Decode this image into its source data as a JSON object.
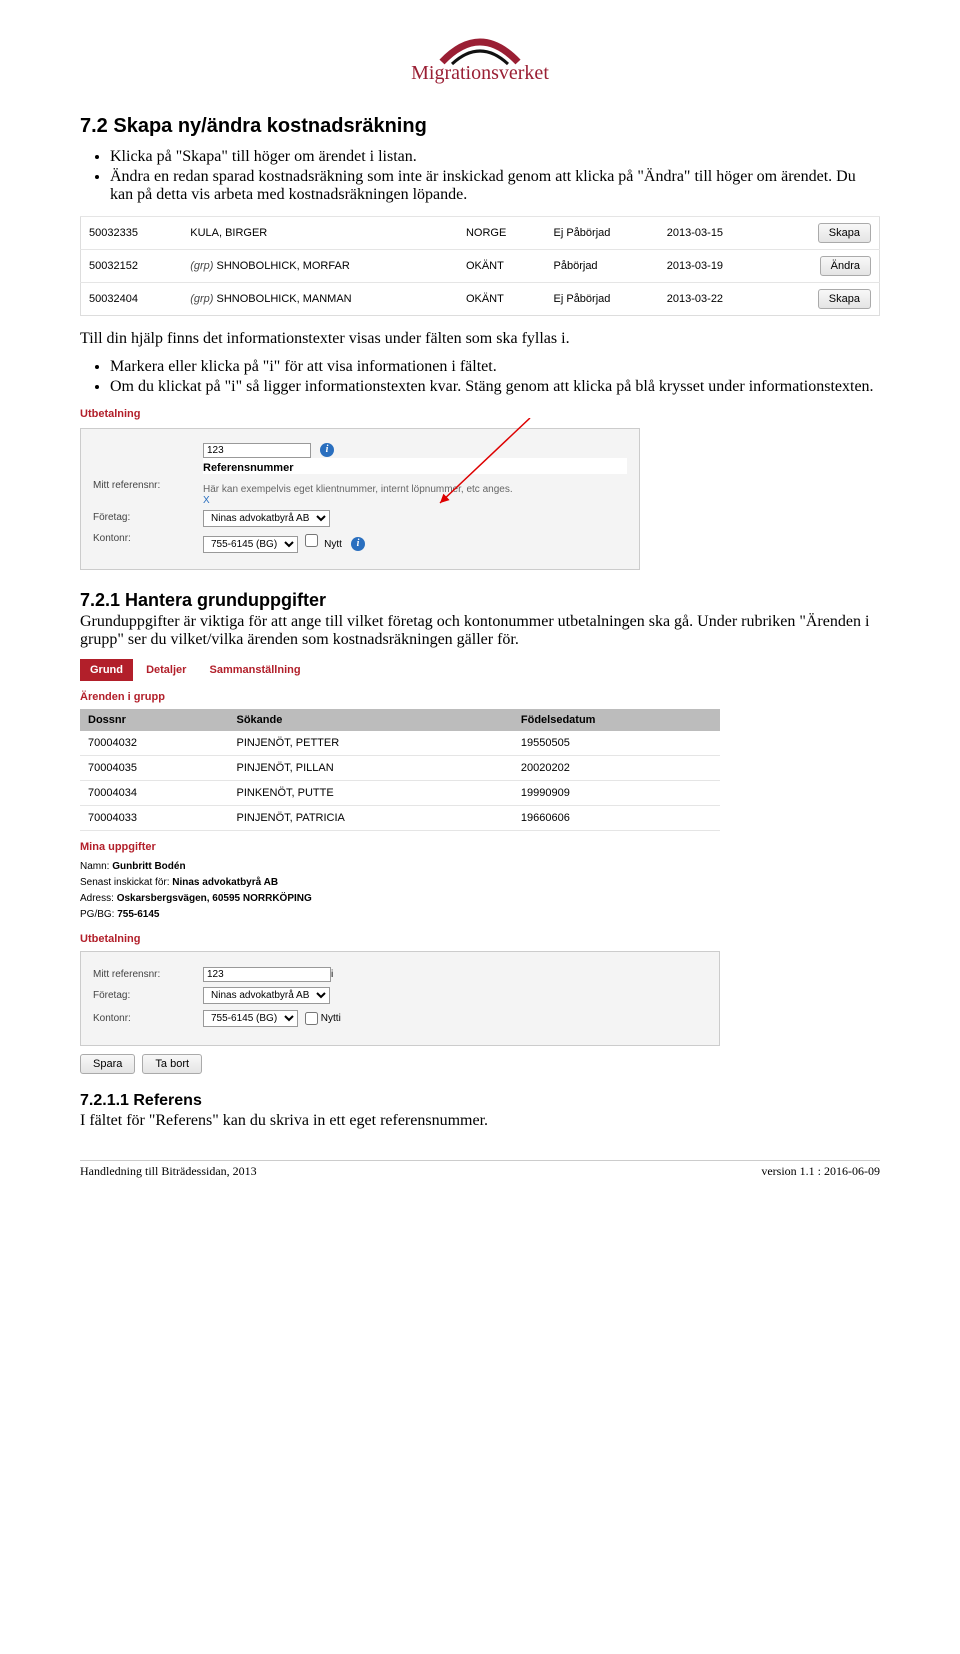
{
  "logo": {
    "text": "Migrationsverket"
  },
  "section72": {
    "title": "7.2  Skapa ny/ändra kostnadsräkning",
    "bullets": [
      "Klicka på \"Skapa\" till höger om ärendet i listan.",
      "Ändra en redan sparad kostnadsräkning som inte är inskickad genom att klicka på \"Ändra\" till höger om ärendet. Du kan på detta vis arbeta med kostnadsräkningen löpande."
    ]
  },
  "shot1": {
    "rows": [
      {
        "id": "50032335",
        "grp": "",
        "name": "KULA, BIRGER",
        "country": "NORGE",
        "status": "Ej Påbörjad",
        "date": "2013-03-15",
        "btn": "Skapa"
      },
      {
        "id": "50032152",
        "grp": "(grp)",
        "name": "SHNOBOLHICK, MORFAR",
        "country": "OKÄNT",
        "status": "Påbörjad",
        "date": "2013-03-19",
        "btn": "Ändra"
      },
      {
        "id": "50032404",
        "grp": "(grp)",
        "name": "SHNOBOLHICK, MANMAN",
        "country": "OKÄNT",
        "status": "Ej Påbörjad",
        "date": "2013-03-22",
        "btn": "Skapa"
      }
    ]
  },
  "helptext": {
    "para": "Till din hjälp finns det informationstexter visas under fälten som ska fyllas i.",
    "bullets": [
      "Markera eller klicka på \"i\" för att visa informationen i fältet.",
      "Om du klickat på \"i\" så ligger informationstexten kvar. Stäng genom att klicka på blå krysset under informationstexten."
    ]
  },
  "shot2": {
    "heading": "Utbetalning",
    "ref_input": "123",
    "popup_title": "Referensnummer",
    "popup_text": "Här kan exempelvis eget klientnummer, internt löpnummer, etc anges.",
    "close": "X",
    "label_refnr": "Mitt referensnr:",
    "label_foretag": "Företag:",
    "foretag_value": "Ninas advokatbyrå AB",
    "label_kontonr": "Kontonr:",
    "kontonr_value": "755-6145 (BG)",
    "nytt": "Nytt"
  },
  "section721": {
    "title": "7.2.1  Hantera grunduppgifter",
    "para": "Grunduppgifter är viktiga för att ange till vilket företag och kontonummer utbetalningen ska gå. Under rubriken \"Ärenden i grupp\" ser du vilket/vilka ärenden som kostnadsräkningen gäller för."
  },
  "shot3": {
    "tabs": [
      "Grund",
      "Detaljer",
      "Sammanställning"
    ],
    "heading_aig": "Ärenden i grupp",
    "cols": [
      "Dossnr",
      "Sökande",
      "Födelsedatum"
    ],
    "rows": [
      {
        "d": "70004032",
        "s": "PINJENÖT, PETTER",
        "f": "19550505"
      },
      {
        "d": "70004035",
        "s": "PINJENÖT, PILLAN",
        "f": "20020202"
      },
      {
        "d": "70004034",
        "s": "PINKENÖT, PUTTE",
        "f": "19990909"
      },
      {
        "d": "70004033",
        "s": "PINJENÖT, PATRICIA",
        "f": "19660606"
      }
    ],
    "heading_mina": "Mina uppgifter",
    "mina": {
      "namn_lbl": "Namn:",
      "namn": "Gunbritt Bodén",
      "senast_lbl": "Senast inskickat för:",
      "senast": "Ninas advokatbyrå AB",
      "adress_lbl": "Adress:",
      "adress": "Oskarsbergsvägen, 60595 NORRKÖPING",
      "pgbg_lbl": "PG/BG:",
      "pgbg": "755-6145"
    },
    "heading_utb": "Utbetalning",
    "form": {
      "ref_lbl": "Mitt referensnr:",
      "ref": "123",
      "foretag_lbl": "Företag:",
      "foretag": "Ninas advokatbyrå AB",
      "kontonr_lbl": "Kontonr:",
      "kontonr": "755-6145 (BG)",
      "nytt": "Nytt"
    },
    "btn_spara": "Spara",
    "btn_tabort": "Ta bort"
  },
  "section7211": {
    "title": "7.2.1.1  Referens",
    "para": "I fältet för \"Referens\" kan du skriva in ett eget referensnummer."
  },
  "footer": {
    "left": "Handledning till Biträdessidan, 2013",
    "right": "version 1.1 : 2016-06-09"
  }
}
